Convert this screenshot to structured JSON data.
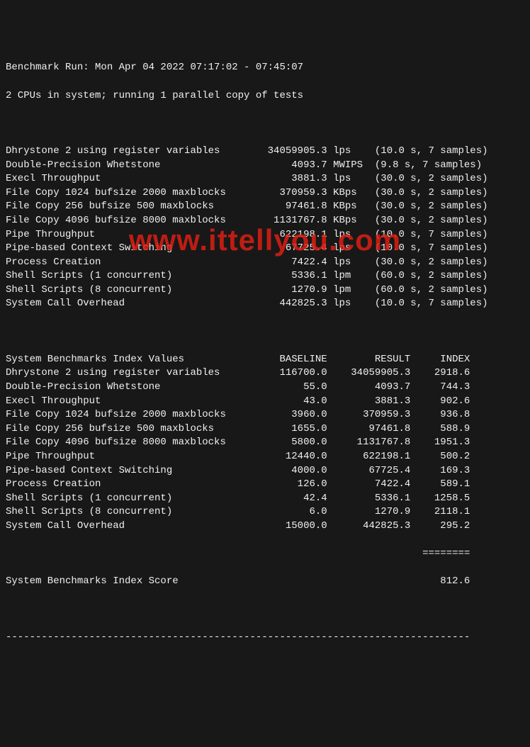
{
  "header": {
    "run_line": "Benchmark Run: Mon Apr 04 2022 07:17:02 - 07:45:07",
    "cpu_line": "2 CPUs in system; running 1 parallel copy of tests"
  },
  "perf": [
    {
      "name": "Dhrystone 2 using register variables",
      "val": "34059905.3",
      "unit": "lps",
      "timing": "(10.0 s, 7 samples)"
    },
    {
      "name": "Double-Precision Whetstone",
      "val": "4093.7",
      "unit": "MWIPS",
      "timing": "(9.8 s, 7 samples)"
    },
    {
      "name": "Execl Throughput",
      "val": "3881.3",
      "unit": "lps",
      "timing": "(30.0 s, 2 samples)"
    },
    {
      "name": "File Copy 1024 bufsize 2000 maxblocks",
      "val": "370959.3",
      "unit": "KBps",
      "timing": "(30.0 s, 2 samples)"
    },
    {
      "name": "File Copy 256 bufsize 500 maxblocks",
      "val": "97461.8",
      "unit": "KBps",
      "timing": "(30.0 s, 2 samples)"
    },
    {
      "name": "File Copy 4096 bufsize 8000 maxblocks",
      "val": "1131767.8",
      "unit": "KBps",
      "timing": "(30.0 s, 2 samples)"
    },
    {
      "name": "Pipe Throughput",
      "val": "622198.1",
      "unit": "lps",
      "timing": "(10.0 s, 7 samples)"
    },
    {
      "name": "Pipe-based Context Switching",
      "val": "67725.4",
      "unit": "lps",
      "timing": "(10.0 s, 7 samples)"
    },
    {
      "name": "Process Creation",
      "val": "7422.4",
      "unit": "lps",
      "timing": "(30.0 s, 2 samples)"
    },
    {
      "name": "Shell Scripts (1 concurrent)",
      "val": "5336.1",
      "unit": "lpm",
      "timing": "(60.0 s, 2 samples)"
    },
    {
      "name": "Shell Scripts (8 concurrent)",
      "val": "1270.9",
      "unit": "lpm",
      "timing": "(60.0 s, 2 samples)"
    },
    {
      "name": "System Call Overhead",
      "val": "442825.3",
      "unit": "lps",
      "timing": "(10.0 s, 7 samples)"
    }
  ],
  "index_header": {
    "label": "System Benchmarks Index Values",
    "baseline": "BASELINE",
    "result": "RESULT",
    "index": "INDEX"
  },
  "index": [
    {
      "name": "Dhrystone 2 using register variables",
      "baseline": "116700.0",
      "result": "34059905.3",
      "index": "2918.6"
    },
    {
      "name": "Double-Precision Whetstone",
      "baseline": "55.0",
      "result": "4093.7",
      "index": "744.3"
    },
    {
      "name": "Execl Throughput",
      "baseline": "43.0",
      "result": "3881.3",
      "index": "902.6"
    },
    {
      "name": "File Copy 1024 bufsize 2000 maxblocks",
      "baseline": "3960.0",
      "result": "370959.3",
      "index": "936.8"
    },
    {
      "name": "File Copy 256 bufsize 500 maxblocks",
      "baseline": "1655.0",
      "result": "97461.8",
      "index": "588.9"
    },
    {
      "name": "File Copy 4096 bufsize 8000 maxblocks",
      "baseline": "5800.0",
      "result": "1131767.8",
      "index": "1951.3"
    },
    {
      "name": "Pipe Throughput",
      "baseline": "12440.0",
      "result": "622198.1",
      "index": "500.2"
    },
    {
      "name": "Pipe-based Context Switching",
      "baseline": "4000.0",
      "result": "67725.4",
      "index": "169.3"
    },
    {
      "name": "Process Creation",
      "baseline": "126.0",
      "result": "7422.4",
      "index": "589.1"
    },
    {
      "name": "Shell Scripts (1 concurrent)",
      "baseline": "42.4",
      "result": "5336.1",
      "index": "1258.5"
    },
    {
      "name": "Shell Scripts (8 concurrent)",
      "baseline": "6.0",
      "result": "1270.9",
      "index": "2118.1"
    },
    {
      "name": "System Call Overhead",
      "baseline": "15000.0",
      "result": "442825.3",
      "index": "295.2"
    }
  ],
  "score": {
    "label": "System Benchmarks Index Score",
    "value": "812.6"
  },
  "watermark": "www.ittellyou.com"
}
